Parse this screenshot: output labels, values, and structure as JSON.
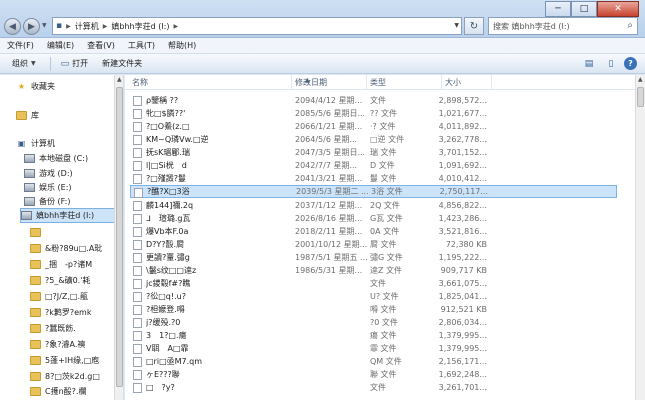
{
  "window": {
    "minimize": "─",
    "maximize": "□",
    "close": "✕"
  },
  "address": {
    "computer": "计算机",
    "drive": "嫃bhh孛荘d (I:)",
    "search_placeholder": "搜索 嫃bhh孛荘d (I:)"
  },
  "menu": [
    "文件(F)",
    "编辑(E)",
    "查看(V)",
    "工具(T)",
    "帮助(H)"
  ],
  "toolbar": {
    "organize": "组织",
    "open": "打开",
    "new_folder": "新建文件夹"
  },
  "sidebar": {
    "favorites": "收藏夹",
    "library": "库",
    "computer": "计算机",
    "drives": [
      "本地磁盘 (C:)",
      "游戏 (D:)",
      "娱乐 (E:)",
      "备份 (F:)",
      "嫃bhh孛荘d (I:)"
    ],
    "folders": [
      "",
      "&粉?89u□.A玭",
      "_捆　-p?诸M",
      "?5_&礦0.'耗",
      "□?J/Z,□.瓹",
      "?k鹣罗?emk",
      "?蠶既飭.",
      "?象?濬A.襫",
      "5蓬+IH缘,□庖",
      "8?□茨k2d.g□",
      "C擭n酘?.欄",
      ""
    ]
  },
  "columns": [
    "名称",
    "修改日期",
    "类型",
    "大小"
  ],
  "files": [
    {
      "name": "ρ鑒稱 ??",
      "date": "2094/4/12 星期...",
      "type": "文件",
      "size": "2,898,572..."
    },
    {
      "name": "牝□$膦??'",
      "date": "2085/5/6 星期日...",
      "type": "?? 文件",
      "size": "1,021,677..."
    },
    {
      "name": "?□O鯗(z.□",
      "date": "2066/1/21 星期...",
      "type": "·? 文件",
      "size": "4,011,892..."
    },
    {
      "name": "KM~Q璘Vw.□逆",
      "date": "2064/5/6 星期...",
      "type": "□逆 文件",
      "size": "3,262,778..."
    },
    {
      "name": "抚sK瑂郿.瑞",
      "date": "2047/3/5 星期日...",
      "type": "瑞 文件",
      "size": "3,701,152..."
    },
    {
      "name": "l|□Si桄　d",
      "date": "2042/7/7 星期...",
      "type": "D 文件",
      "size": "1,091,692..."
    },
    {
      "name": "?□殣譭?鬘",
      "date": "2041/3/21 星期...",
      "type": "鬘 文件",
      "size": "4,010,412..."
    },
    {
      "name": "?醮?X□3浴",
      "date": "2039/5/3 星期二 ...",
      "type": "3浴 文件",
      "size": "2,750,117..."
    },
    {
      "name": "麟144]禰.2q",
      "date": "2037/1/12 星期...",
      "type": "2Q 文件",
      "size": "4,856,822..."
    },
    {
      "name": "ᒧ　瑄璐.g瓦",
      "date": "2026/8/16 星期...",
      "type": "G瓦 文件",
      "size": "1,423,286..."
    },
    {
      "name": "爆Vb本F.0a",
      "date": "2018/2/11 星期...",
      "type": "0A 文件",
      "size": "3,521,816..."
    },
    {
      "name": "D?Y?瞉.屙",
      "date": "2001/10/12 星期...",
      "type": "屙 文件",
      "size": "72,380 KB"
    },
    {
      "name": "更讀?罿.彇g",
      "date": "1987/5/1 星期五 ...",
      "type": "彇G 文件",
      "size": "1,195,222..."
    },
    {
      "name": "\\鬣s纹□□逹z",
      "date": "1986/5/31 星期...",
      "type": "逹Z 文件",
      "size": "909,717 KB"
    },
    {
      "name": "jc鑁毂f#?瞧",
      "date": "",
      "type": "文件",
      "size": "3,661,075..."
    },
    {
      "name": "?彸□q!.u?",
      "date": "",
      "type": "U? 文件",
      "size": "1,825,041..."
    },
    {
      "name": "?柦嬤登.嘚",
      "date": "",
      "type": "嘚 文件",
      "size": "912,521 KB"
    },
    {
      "name": "j?缓殁.?0",
      "date": "",
      "type": "?0 文件",
      "size": "2,806,034..."
    },
    {
      "name": "3　1?□.瘍",
      "date": "",
      "type": "瘍 文件",
      "size": "1,379,995..."
    },
    {
      "name": "V聑　A□霏",
      "date": "",
      "type": "霏 文件",
      "size": "1,379,995..."
    },
    {
      "name": "□ri□亟M7.qm",
      "date": "",
      "type": "QM 文件",
      "size": "2,156,171..."
    },
    {
      "name": "ヶE???聯",
      "date": "",
      "type": "聯 文件",
      "size": "1,692,248..."
    },
    {
      "name": "□　?y?",
      "date": "",
      "type": "文件",
      "size": "3,261,701..."
    }
  ]
}
